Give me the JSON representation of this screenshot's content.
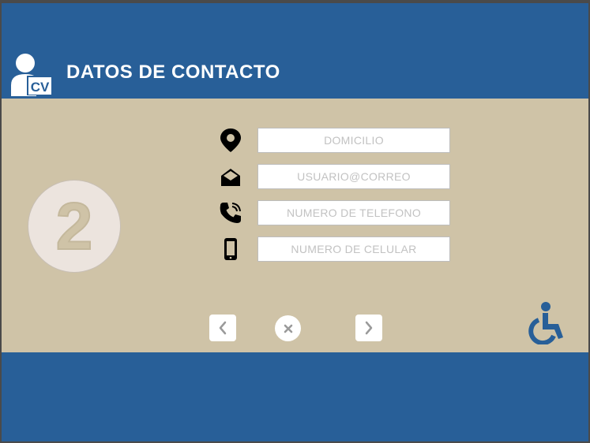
{
  "header": {
    "title": "DATOS DE CONTACTO",
    "logo_icon": "cv-user-icon",
    "logo_text": "CV"
  },
  "step": {
    "number": "2"
  },
  "form": {
    "fields": [
      {
        "icon": "map-pin-icon",
        "placeholder": "DOMICILIO",
        "value": ""
      },
      {
        "icon": "envelope-icon",
        "placeholder": "USUARIO@CORREO",
        "value": ""
      },
      {
        "icon": "phone-icon",
        "placeholder": "NUMERO DE TELEFONO",
        "value": ""
      },
      {
        "icon": "mobile-phone-icon",
        "placeholder": "NUMERO DE CELULAR",
        "value": ""
      }
    ]
  },
  "navigation": {
    "prev_icon": "chevron-left-icon",
    "close_icon": "close-icon",
    "next_icon": "chevron-right-icon",
    "accessibility_icon": "wheelchair-icon"
  },
  "colors": {
    "primary_blue": "#285f98",
    "panel_beige": "#cfc3a7",
    "circle_bg": "#ece4de",
    "white": "#ffffff",
    "icon_gray": "#9a9a9a"
  }
}
